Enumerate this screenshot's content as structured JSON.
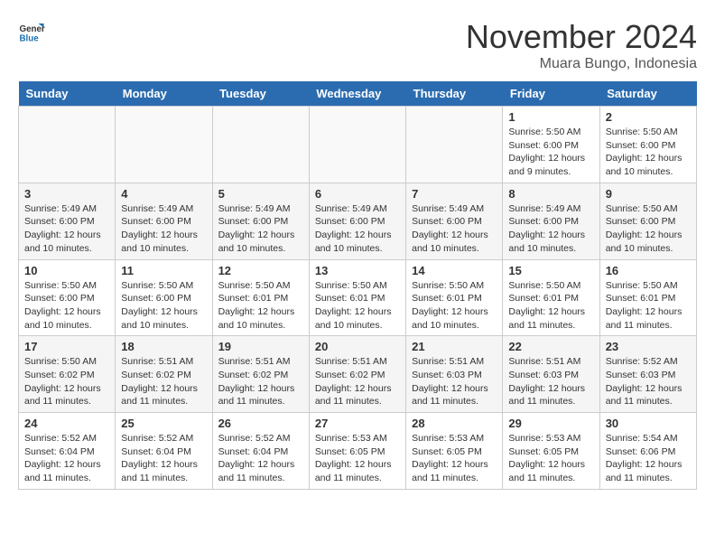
{
  "header": {
    "logo_general": "General",
    "logo_blue": "Blue",
    "month_title": "November 2024",
    "location": "Muara Bungo, Indonesia"
  },
  "weekdays": [
    "Sunday",
    "Monday",
    "Tuesday",
    "Wednesday",
    "Thursday",
    "Friday",
    "Saturday"
  ],
  "weeks": [
    [
      {
        "day": "",
        "info": ""
      },
      {
        "day": "",
        "info": ""
      },
      {
        "day": "",
        "info": ""
      },
      {
        "day": "",
        "info": ""
      },
      {
        "day": "",
        "info": ""
      },
      {
        "day": "1",
        "info": "Sunrise: 5:50 AM\nSunset: 6:00 PM\nDaylight: 12 hours and 9 minutes."
      },
      {
        "day": "2",
        "info": "Sunrise: 5:50 AM\nSunset: 6:00 PM\nDaylight: 12 hours and 10 minutes."
      }
    ],
    [
      {
        "day": "3",
        "info": "Sunrise: 5:49 AM\nSunset: 6:00 PM\nDaylight: 12 hours and 10 minutes."
      },
      {
        "day": "4",
        "info": "Sunrise: 5:49 AM\nSunset: 6:00 PM\nDaylight: 12 hours and 10 minutes."
      },
      {
        "day": "5",
        "info": "Sunrise: 5:49 AM\nSunset: 6:00 PM\nDaylight: 12 hours and 10 minutes."
      },
      {
        "day": "6",
        "info": "Sunrise: 5:49 AM\nSunset: 6:00 PM\nDaylight: 12 hours and 10 minutes."
      },
      {
        "day": "7",
        "info": "Sunrise: 5:49 AM\nSunset: 6:00 PM\nDaylight: 12 hours and 10 minutes."
      },
      {
        "day": "8",
        "info": "Sunrise: 5:49 AM\nSunset: 6:00 PM\nDaylight: 12 hours and 10 minutes."
      },
      {
        "day": "9",
        "info": "Sunrise: 5:50 AM\nSunset: 6:00 PM\nDaylight: 12 hours and 10 minutes."
      }
    ],
    [
      {
        "day": "10",
        "info": "Sunrise: 5:50 AM\nSunset: 6:00 PM\nDaylight: 12 hours and 10 minutes."
      },
      {
        "day": "11",
        "info": "Sunrise: 5:50 AM\nSunset: 6:00 PM\nDaylight: 12 hours and 10 minutes."
      },
      {
        "day": "12",
        "info": "Sunrise: 5:50 AM\nSunset: 6:01 PM\nDaylight: 12 hours and 10 minutes."
      },
      {
        "day": "13",
        "info": "Sunrise: 5:50 AM\nSunset: 6:01 PM\nDaylight: 12 hours and 10 minutes."
      },
      {
        "day": "14",
        "info": "Sunrise: 5:50 AM\nSunset: 6:01 PM\nDaylight: 12 hours and 10 minutes."
      },
      {
        "day": "15",
        "info": "Sunrise: 5:50 AM\nSunset: 6:01 PM\nDaylight: 12 hours and 11 minutes."
      },
      {
        "day": "16",
        "info": "Sunrise: 5:50 AM\nSunset: 6:01 PM\nDaylight: 12 hours and 11 minutes."
      }
    ],
    [
      {
        "day": "17",
        "info": "Sunrise: 5:50 AM\nSunset: 6:02 PM\nDaylight: 12 hours and 11 minutes."
      },
      {
        "day": "18",
        "info": "Sunrise: 5:51 AM\nSunset: 6:02 PM\nDaylight: 12 hours and 11 minutes."
      },
      {
        "day": "19",
        "info": "Sunrise: 5:51 AM\nSunset: 6:02 PM\nDaylight: 12 hours and 11 minutes."
      },
      {
        "day": "20",
        "info": "Sunrise: 5:51 AM\nSunset: 6:02 PM\nDaylight: 12 hours and 11 minutes."
      },
      {
        "day": "21",
        "info": "Sunrise: 5:51 AM\nSunset: 6:03 PM\nDaylight: 12 hours and 11 minutes."
      },
      {
        "day": "22",
        "info": "Sunrise: 5:51 AM\nSunset: 6:03 PM\nDaylight: 12 hours and 11 minutes."
      },
      {
        "day": "23",
        "info": "Sunrise: 5:52 AM\nSunset: 6:03 PM\nDaylight: 12 hours and 11 minutes."
      }
    ],
    [
      {
        "day": "24",
        "info": "Sunrise: 5:52 AM\nSunset: 6:04 PM\nDaylight: 12 hours and 11 minutes."
      },
      {
        "day": "25",
        "info": "Sunrise: 5:52 AM\nSunset: 6:04 PM\nDaylight: 12 hours and 11 minutes."
      },
      {
        "day": "26",
        "info": "Sunrise: 5:52 AM\nSunset: 6:04 PM\nDaylight: 12 hours and 11 minutes."
      },
      {
        "day": "27",
        "info": "Sunrise: 5:53 AM\nSunset: 6:05 PM\nDaylight: 12 hours and 11 minutes."
      },
      {
        "day": "28",
        "info": "Sunrise: 5:53 AM\nSunset: 6:05 PM\nDaylight: 12 hours and 11 minutes."
      },
      {
        "day": "29",
        "info": "Sunrise: 5:53 AM\nSunset: 6:05 PM\nDaylight: 12 hours and 11 minutes."
      },
      {
        "day": "30",
        "info": "Sunrise: 5:54 AM\nSunset: 6:06 PM\nDaylight: 12 hours and 11 minutes."
      }
    ]
  ]
}
